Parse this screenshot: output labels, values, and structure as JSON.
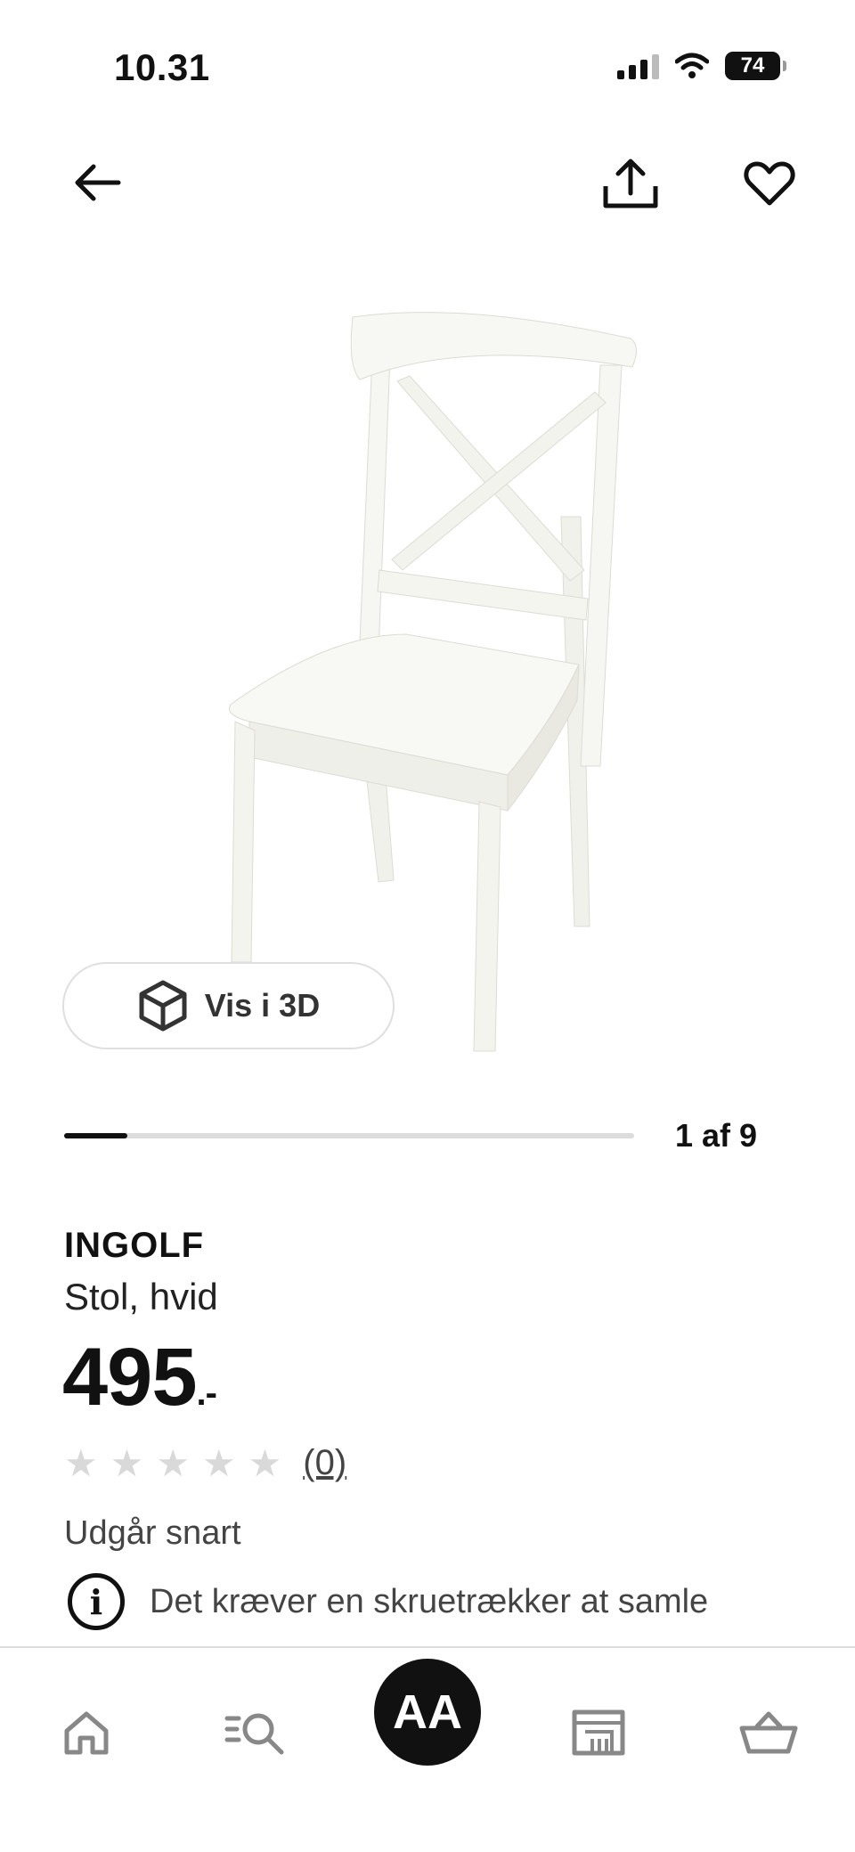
{
  "status": {
    "time": "10.31",
    "battery": "74"
  },
  "product": {
    "name": "INGOLF",
    "description": "Stol, hvid",
    "price": "495",
    "price_suffix": ".-",
    "rating_stars": 0,
    "reviews": "(0)",
    "availability": "Udgår snart",
    "info": "Det kræver en skruetrækker at samle"
  },
  "media": {
    "view_3d_label": "Vis i 3D",
    "counter": "1 af 9",
    "progress": 0.111
  },
  "nav": {
    "icons": [
      "arrow-left-icon",
      "share-icon",
      "heart-icon"
    ]
  },
  "tabbar": {
    "account_initials": "AA",
    "icons": [
      "home-icon",
      "search-list-icon",
      "account-avatar",
      "store-icon",
      "basket-icon"
    ]
  }
}
